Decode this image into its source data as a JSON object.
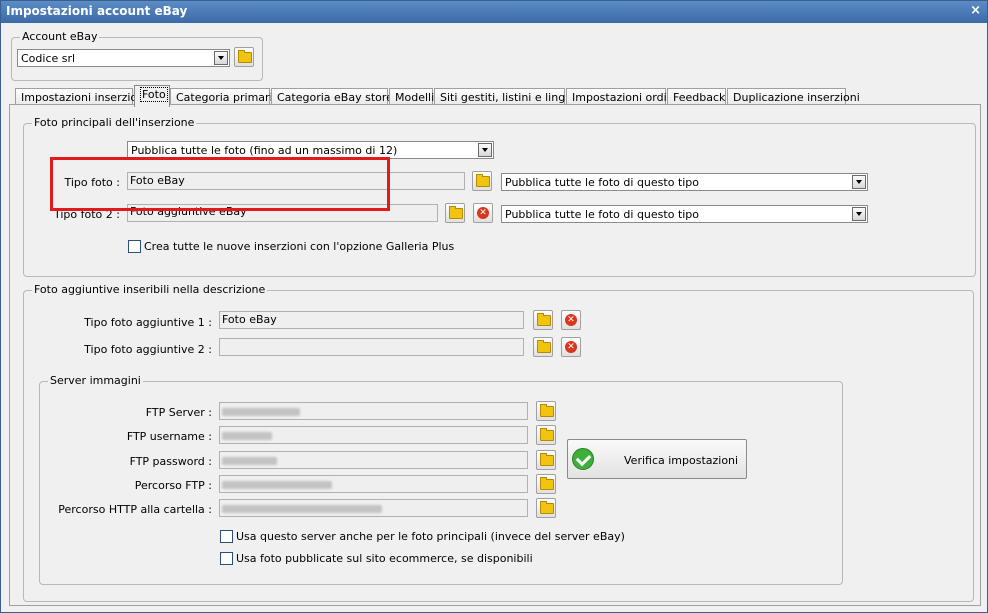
{
  "window": {
    "title": "Impostazioni account eBay",
    "close_label": "×"
  },
  "account": {
    "legend": "Account eBay",
    "selected": "Codice srl"
  },
  "tabs": [
    {
      "label": "Impostazioni inserzioni"
    },
    {
      "label": "Foto"
    },
    {
      "label": "Categoria primaria"
    },
    {
      "label": "Categoria eBay store"
    },
    {
      "label": "Modelli"
    },
    {
      "label": "Siti gestiti, listini e lingue"
    },
    {
      "label": "Impostazioni ordini"
    },
    {
      "label": "Feedback"
    },
    {
      "label": "Duplicazione inserzioni"
    }
  ],
  "foto_principali": {
    "legend": "Foto principali dell'inserzione",
    "publish_select": "Pubblica tutte le foto (fino ad un massimo di 12)",
    "tipo_foto_label": "Tipo foto :",
    "tipo_foto_value": "Foto eBay",
    "tipo_foto_select": "Pubblica tutte le foto di questo tipo",
    "tipo_foto2_label": "Tipo foto 2 :",
    "tipo_foto2_value": "Foto aggiuntive eBay",
    "tipo_foto2_select": "Pubblica tutte le foto di questo tipo",
    "galleria_plus_label": "Crea tutte le nuove inserzioni con l'opzione Galleria Plus"
  },
  "foto_aggiuntive": {
    "legend": "Foto aggiuntive inseribili nella descrizione",
    "tipo1_label": "Tipo foto aggiuntive 1 :",
    "tipo1_value": "Foto eBay",
    "tipo2_label": "Tipo foto aggiuntive 2 :",
    "tipo2_value": ""
  },
  "server": {
    "legend": "Server immagini",
    "ftp_server_label": "FTP Server :",
    "ftp_username_label": "FTP username :",
    "ftp_password_label": "FTP password :",
    "percorso_ftp_label": "Percorso FTP :",
    "percorso_http_label": "Percorso HTTP alla cartella :",
    "verify_label": "Verifica impostazioni",
    "use_server_label": "Usa questo server anche per le foto principali (invece del server eBay)",
    "use_site_label": "Usa foto pubblicate sul sito ecommerce, se disponibili"
  }
}
